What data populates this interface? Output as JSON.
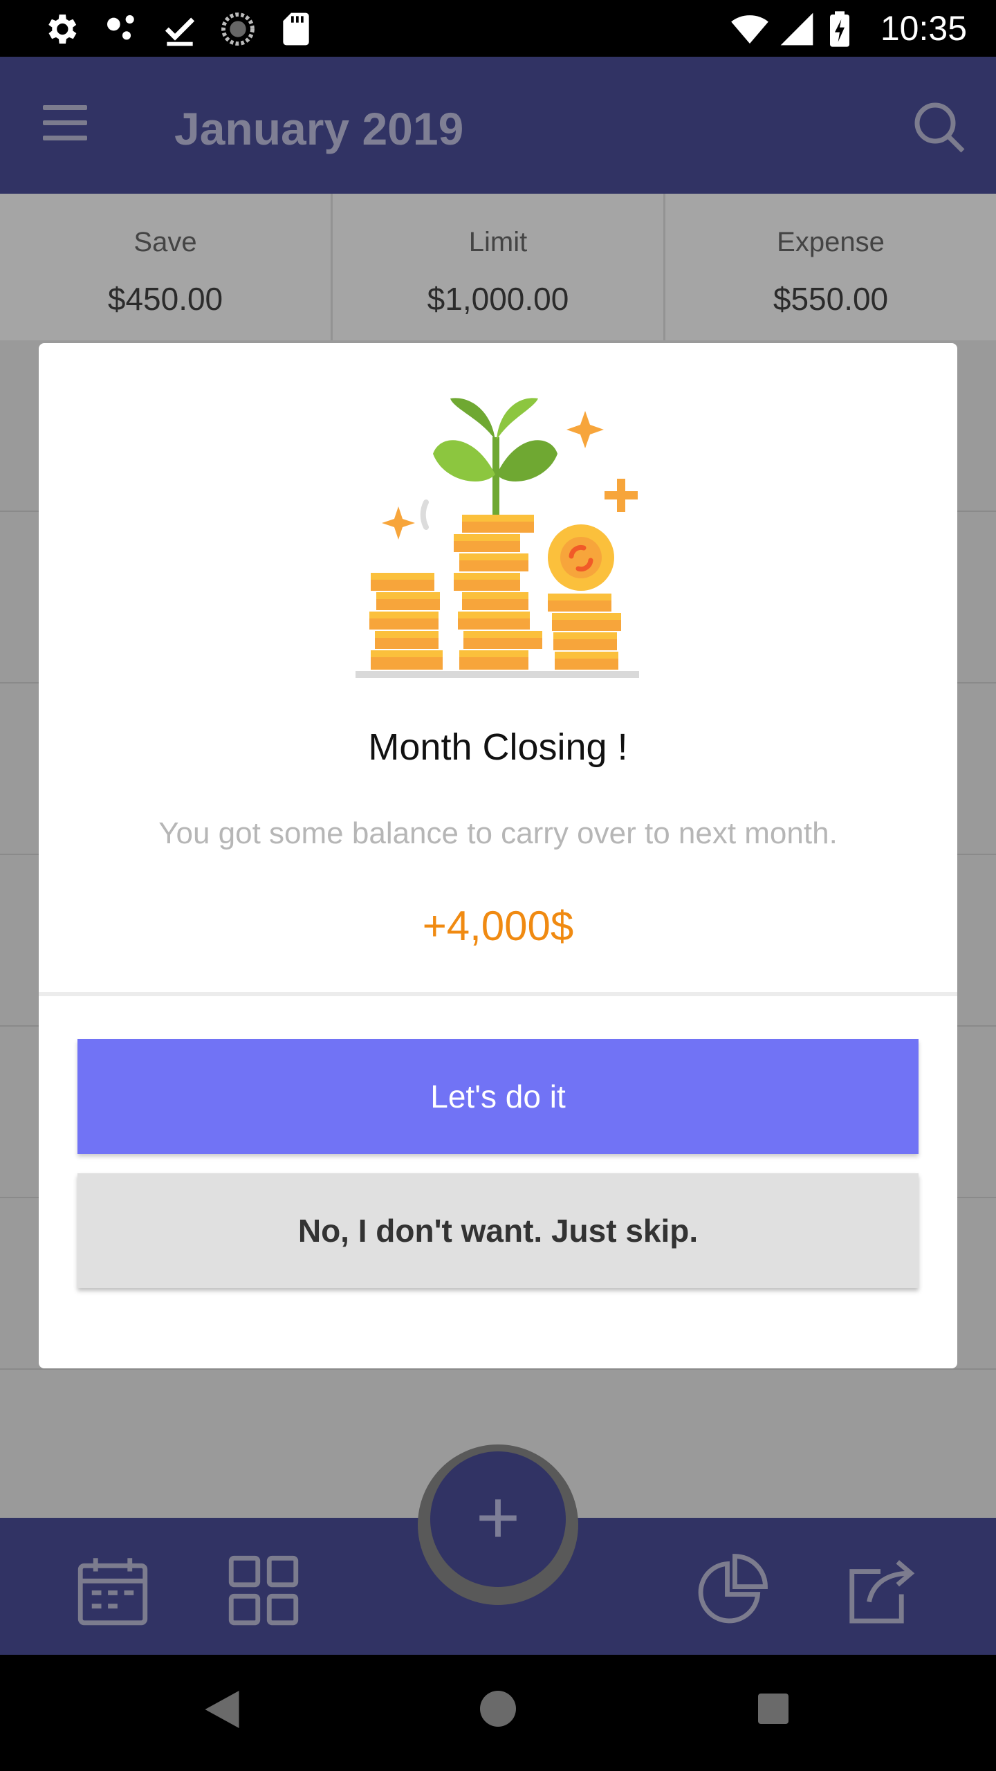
{
  "status_bar": {
    "time": "10:35",
    "icons": [
      "settings-icon",
      "nodes-icon",
      "download-done-icon",
      "sync-icon",
      "sd-card-icon",
      "wifi-icon",
      "signal-icon",
      "battery-charging-icon"
    ]
  },
  "app_bar": {
    "title": "January 2019",
    "icons": [
      "menu-icon",
      "search-icon"
    ]
  },
  "summary": {
    "items": [
      {
        "label": "Save",
        "value": "$450.00"
      },
      {
        "label": "Limit",
        "value": "$1,000.00"
      },
      {
        "label": "Expense",
        "value": "$550.00"
      }
    ]
  },
  "dialog": {
    "title": "Month Closing !",
    "message": "You got some balance to carry over to next month.",
    "amount": "+4,000$",
    "primary_button": "Let's do it",
    "secondary_button": "No, I don't want. Just skip.",
    "amount_color": "#f08a11",
    "primary_color": "#7173f5"
  },
  "bottom_bar": {
    "fab_label": "+",
    "icons": [
      "calendar-icon",
      "grid-icon",
      "pie-chart-icon",
      "share-icon"
    ]
  },
  "colors": {
    "app_bar": "#313364",
    "scrim_background": "#9a9a9a"
  }
}
